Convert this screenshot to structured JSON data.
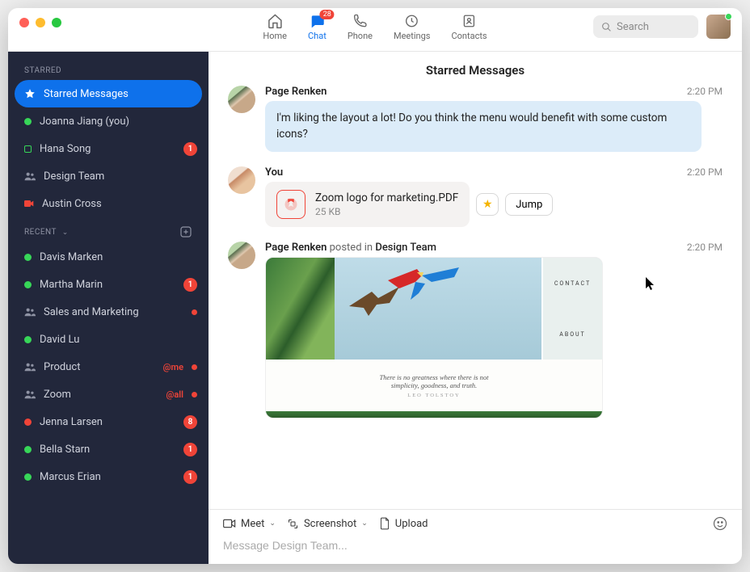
{
  "topnav": {
    "items": [
      {
        "label": "Home"
      },
      {
        "label": "Chat",
        "badge": "28"
      },
      {
        "label": "Phone"
      },
      {
        "label": "Meetings"
      },
      {
        "label": "Contacts"
      }
    ]
  },
  "search": {
    "placeholder": "Search"
  },
  "sidebar": {
    "starred_header": "STARRED",
    "recent_header": "RECENT",
    "starred": [
      {
        "label": "Starred Messages"
      },
      {
        "label": "Joanna Jiang (you)"
      },
      {
        "label": "Hana Song",
        "badge": "1"
      },
      {
        "label": "Design Team"
      },
      {
        "label": "Austin Cross"
      }
    ],
    "recent": [
      {
        "label": "Davis Marken"
      },
      {
        "label": "Martha Marin",
        "badge": "1"
      },
      {
        "label": "Sales and Marketing"
      },
      {
        "label": "David Lu"
      },
      {
        "label": "Product",
        "mention": "@me"
      },
      {
        "label": "Zoom",
        "mention": "@all"
      },
      {
        "label": "Jenna Larsen",
        "badge": "8"
      },
      {
        "label": "Bella Starn",
        "badge": "1"
      },
      {
        "label": "Marcus Erian",
        "badge": "1"
      }
    ]
  },
  "main": {
    "title": "Starred Messages",
    "messages": [
      {
        "author": "Page Renken",
        "time": "2:20 PM",
        "text": "I'm liking the layout a lot! Do you think the menu would benefit with some custom icons?"
      },
      {
        "author": "You",
        "time": "2:20 PM",
        "file": {
          "name": "Zoom logo for marketing.PDF",
          "size": "25 KB"
        },
        "jump_label": "Jump"
      },
      {
        "author": "Page Renken",
        "posted_in": "posted in",
        "channel": "Design Team",
        "time": "2:20 PM",
        "preview": {
          "right_links": [
            "CONTACT",
            "ABOUT"
          ],
          "quote1": "There is no greatness where there is not",
          "quote2": "simplicity, goodness, and truth.",
          "attrib": "LEO TOLSTOY"
        }
      }
    ]
  },
  "footer": {
    "meet": "Meet",
    "screenshot": "Screenshot",
    "upload": "Upload",
    "placeholder": "Message Design Team..."
  }
}
